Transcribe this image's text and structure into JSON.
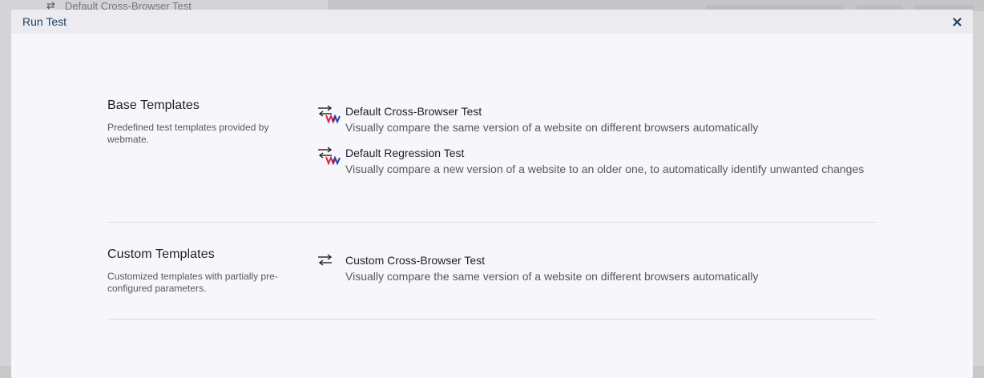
{
  "background": {
    "row_label": "Default Cross-Browser Test"
  },
  "modal": {
    "title": "Run Test",
    "close_icon": "close-icon"
  },
  "sections": [
    {
      "title": "Base Templates",
      "description": "Predefined test templates provided by webmate.",
      "templates": [
        {
          "name": "Default Cross-Browser Test",
          "description": "Visually compare the same version of a website on different browsers automatically",
          "icon": "webmate-swap-icon"
        },
        {
          "name": "Default Regression Test",
          "description": "Visually compare a new version of a website to an older one, to automatically identify unwanted changes",
          "icon": "webmate-swap-icon"
        }
      ]
    },
    {
      "title": "Custom Templates",
      "description": "Customized templates with partially pre-configured parameters.",
      "templates": [
        {
          "name": "Custom Cross-Browser Test",
          "description": "Visually compare the same version of a website on different browsers automatically",
          "icon": "swap-arrows-icon"
        }
      ]
    }
  ],
  "colors": {
    "title_text": "#1f3f67",
    "modal_bg": "#f7f7fb",
    "header_bg": "#ececf0",
    "logo_red": "#e2213b",
    "logo_blue": "#2b3fa8"
  }
}
